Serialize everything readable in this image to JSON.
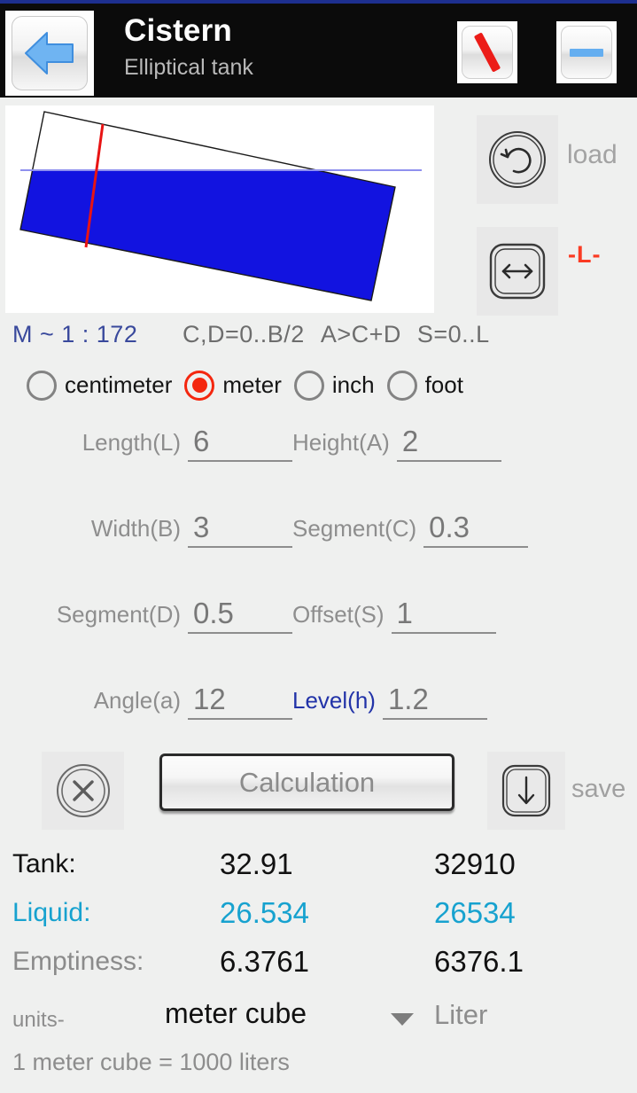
{
  "titlebar": {
    "back_icon": "back-arrow-icon",
    "title": "Cistern",
    "subtitle": "Elliptical tank",
    "slash_icon": "red-slash-icon",
    "minus_icon": "blue-minus-icon"
  },
  "diagram": {
    "name": "tank-cross-section",
    "tank_outline_color": "#1a1a1a",
    "liquid_color": "#1213e0",
    "level_marker_color": "#e81414",
    "background": "#ffffff"
  },
  "side_controls": {
    "load_icon": "undo-circle-icon",
    "load_label": "load",
    "resize_icon": "arrows-horizontal-icon",
    "resize_label": "-L-",
    "resize_label_color": "#fa3b23"
  },
  "scale": {
    "value": "M ~ 1 : 172",
    "value_color": "#39499c",
    "rules": [
      "C,D=0..B/2",
      "A>C+D",
      "S=0..L"
    ]
  },
  "units_radio": {
    "options": [
      {
        "label": "centimeter",
        "selected": false
      },
      {
        "label": "meter",
        "selected": true
      },
      {
        "label": "inch",
        "selected": false
      },
      {
        "label": "foot",
        "selected": false
      }
    ],
    "selected_color": "#f4270f"
  },
  "fields": [
    [
      {
        "label": "Length(L)",
        "value": "6",
        "accent": false
      },
      {
        "label": "Height(A)",
        "value": "2",
        "accent": false
      }
    ],
    [
      {
        "label": "Width(B)",
        "value": "3",
        "accent": false
      },
      {
        "label": "Segment(C)",
        "value": "0.3",
        "accent": false
      }
    ],
    [
      {
        "label": "Segment(D)",
        "value": "0.5",
        "accent": false
      },
      {
        "label": "Offset(S)",
        "value": "1",
        "accent": false
      }
    ],
    [
      {
        "label": "Angle(a)",
        "value": "12",
        "accent": false
      },
      {
        "label": "Level(h)",
        "value": "1.2",
        "accent": true
      }
    ]
  ],
  "actions": {
    "clear_icon": "circle-x-icon",
    "calculation_label": "Calculation",
    "save_icon": "download-arrow-icon",
    "save_label": "save"
  },
  "results": {
    "rows": [
      {
        "label": "Tank:",
        "value_primary": "32.91",
        "value_secondary": "32910",
        "color": "#111111"
      },
      {
        "label": "Liquid:",
        "value_primary": "26.534",
        "value_secondary": "26534",
        "color": "#17a2cf"
      },
      {
        "label": "Emptiness:",
        "value_primary": "6.3761",
        "value_secondary": "6376.1",
        "color": "#111111"
      }
    ]
  },
  "units_footer": {
    "label": "units-",
    "selected": "meter cube",
    "dropdown_icon": "chevron-down-icon",
    "secondary": "Liter",
    "note": "1 meter cube = 1000 liters"
  }
}
